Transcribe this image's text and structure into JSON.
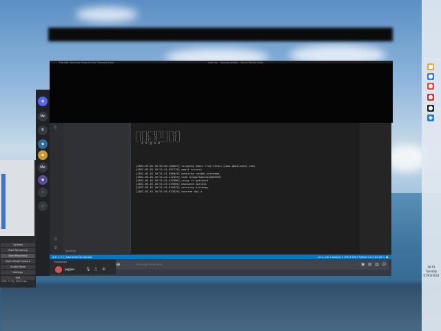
{
  "window_menu": "File  Edit  Selection  View  Go  Run  Terminal  Help",
  "window_title": "main.py - discord-selfbot - Visual Studio Code",
  "servers": [
    "Mc",
    "R",
    "Me",
    "+"
  ],
  "ascii_logo": " _  _  __  _  _  _  _ \n| || |/ _|| || || \\/ |\n| || |\\_ \\| || || \\/ |\n|_||_||__/|____||_||_|\n   d e g a m",
  "log_lines": [
    "[2022-03-01 10:51:40.100057] scraping email from https://www.gmailnator.com/",
    "[2022-03-01 10:51:41.497775] email success",
    "[2022-03-01 10:51:41.396043] entering random username",
    "[2022-03-01 10:51:41.112453] used GregorSweeney0329539",
    "[2022-03-01 10:51:42.437000] using rx password",
    "[2022-03-01 10:51:43.325504] password success",
    "[2022-03-01 10:51:43.610322] entering birthday",
    "[2022-03-01 10:51:46.874629] entered day 4"
  ],
  "status_bar": {
    "left": "⊗ 0 ⚠ 0  ⓘ Connected to Discord",
    "right": "Ln 1, Col 1   Spaces: 2   UTF-8   CRLF   Python   3.8.5 64-bit   ⚇ 🔔"
  },
  "terminal_tab": "terminal",
  "connect_strip": "Connected",
  "user": {
    "name": "pepper"
  },
  "message_placeholder": "Message #general",
  "obs": {
    "buttons": [
      "Controls",
      "Start Streaming",
      "Start Recording",
      "Start Virtual Camera",
      "Studio Mode",
      "Settings",
      "Exit"
    ],
    "stats": "CPU: 7.7%, 30.00 fps"
  },
  "clock": {
    "time": "10:51",
    "day": "Tuesday",
    "date": "01/03/2022"
  },
  "colors": {
    "accent": "#007acc",
    "discord": "#5865f2"
  }
}
